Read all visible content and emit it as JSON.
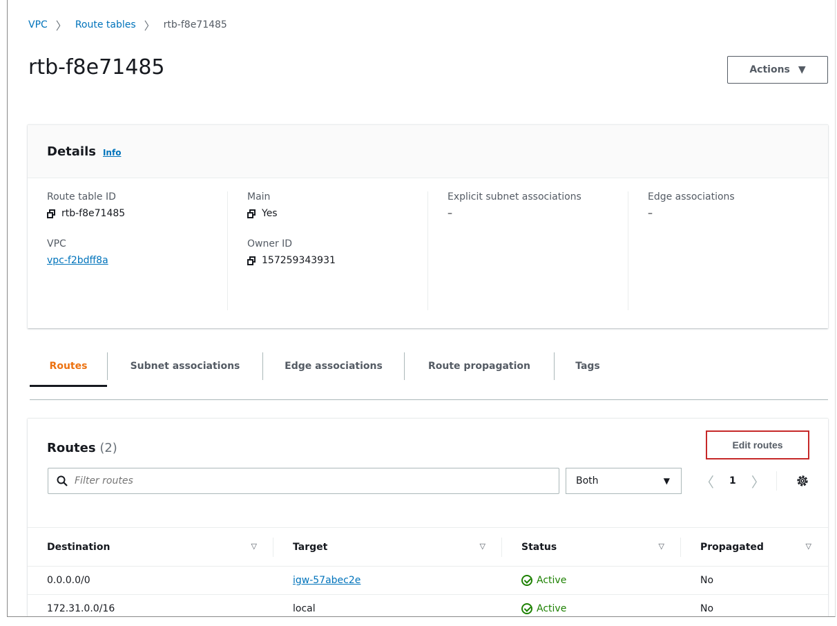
{
  "breadcrumb": {
    "items": [
      "VPC",
      "Route tables"
    ],
    "current": "rtb-f8e71485"
  },
  "page": {
    "title": "rtb-f8e71485",
    "actions_label": "Actions"
  },
  "details": {
    "title": "Details",
    "info": "Info",
    "route_table_id_label": "Route table ID",
    "route_table_id": "rtb-f8e71485",
    "vpc_label": "VPC",
    "vpc": "vpc-f2bdff8a",
    "main_label": "Main",
    "main": "Yes",
    "owner_label": "Owner ID",
    "owner": "157259343931",
    "explicit_label": "Explicit subnet associations",
    "explicit": "–",
    "edge_label": "Edge associations",
    "edge": "–"
  },
  "tabs": [
    "Routes",
    "Subnet associations",
    "Edge associations",
    "Route propagation",
    "Tags"
  ],
  "routes": {
    "title": "Routes",
    "count": "(2)",
    "edit_label": "Edit routes",
    "filter_placeholder": "Filter routes",
    "select_value": "Both",
    "page": "1",
    "columns": [
      "Destination",
      "Target",
      "Status",
      "Propagated"
    ],
    "rows": [
      {
        "destination": "0.0.0.0/0",
        "target": "igw-57abec2e",
        "status": "Active",
        "propagated": "No"
      },
      {
        "destination": "172.31.0.0/16",
        "target": "local",
        "status": "Active",
        "propagated": "No"
      }
    ]
  },
  "colors": {
    "accent": "#ec7211",
    "link": "#0073bb",
    "success": "#1d8102",
    "highlight": "#c62828"
  }
}
